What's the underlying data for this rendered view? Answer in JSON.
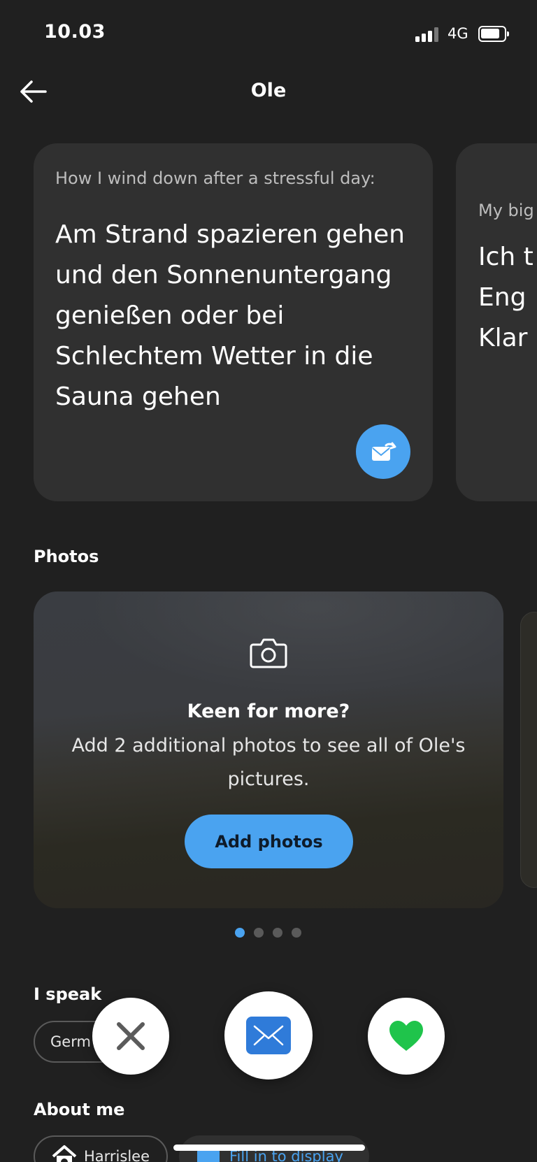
{
  "status_bar": {
    "time": "10.03",
    "network": "4G",
    "signal_bars": 3,
    "battery_level": 0.8
  },
  "header": {
    "title": "Ole",
    "back_icon": "arrow-left-icon"
  },
  "prompt_cards": [
    {
      "label": "How I wind down after a stressful day:",
      "answer": "Am Strand spazieren gehen und den Sonnenuntergang genießen oder bei Schlechtem Wetter in die Sauna gehen",
      "reply_icon": "envelope-reply-icon"
    },
    {
      "label": "My big",
      "answer_lines": [
        "Ich t",
        "Eng",
        "Klar"
      ]
    }
  ],
  "photos": {
    "heading": "Photos",
    "icon": "camera-icon",
    "title": "Keen for more?",
    "description": "Add 2 additional photos to see all of Ole's pictures.",
    "button_label": "Add photos",
    "pagination": {
      "total": 4,
      "active": 1
    }
  },
  "languages": {
    "heading": "I speak",
    "items": [
      "Germ"
    ]
  },
  "about": {
    "heading": "About me",
    "chips": [
      {
        "label": "Harrislee",
        "icon": "home-location-icon"
      },
      {
        "label": "Fill in to display",
        "icon": "calendar-icon"
      }
    ]
  },
  "actions": {
    "dislike_icon": "close-x-icon",
    "message_icon": "envelope-icon",
    "like_icon": "heart-icon"
  },
  "colors": {
    "background": "#202020",
    "card": "#303030",
    "accent_blue": "#4aa3f0",
    "like_green": "#1fc44b",
    "message_blue": "#2f7bd9"
  }
}
